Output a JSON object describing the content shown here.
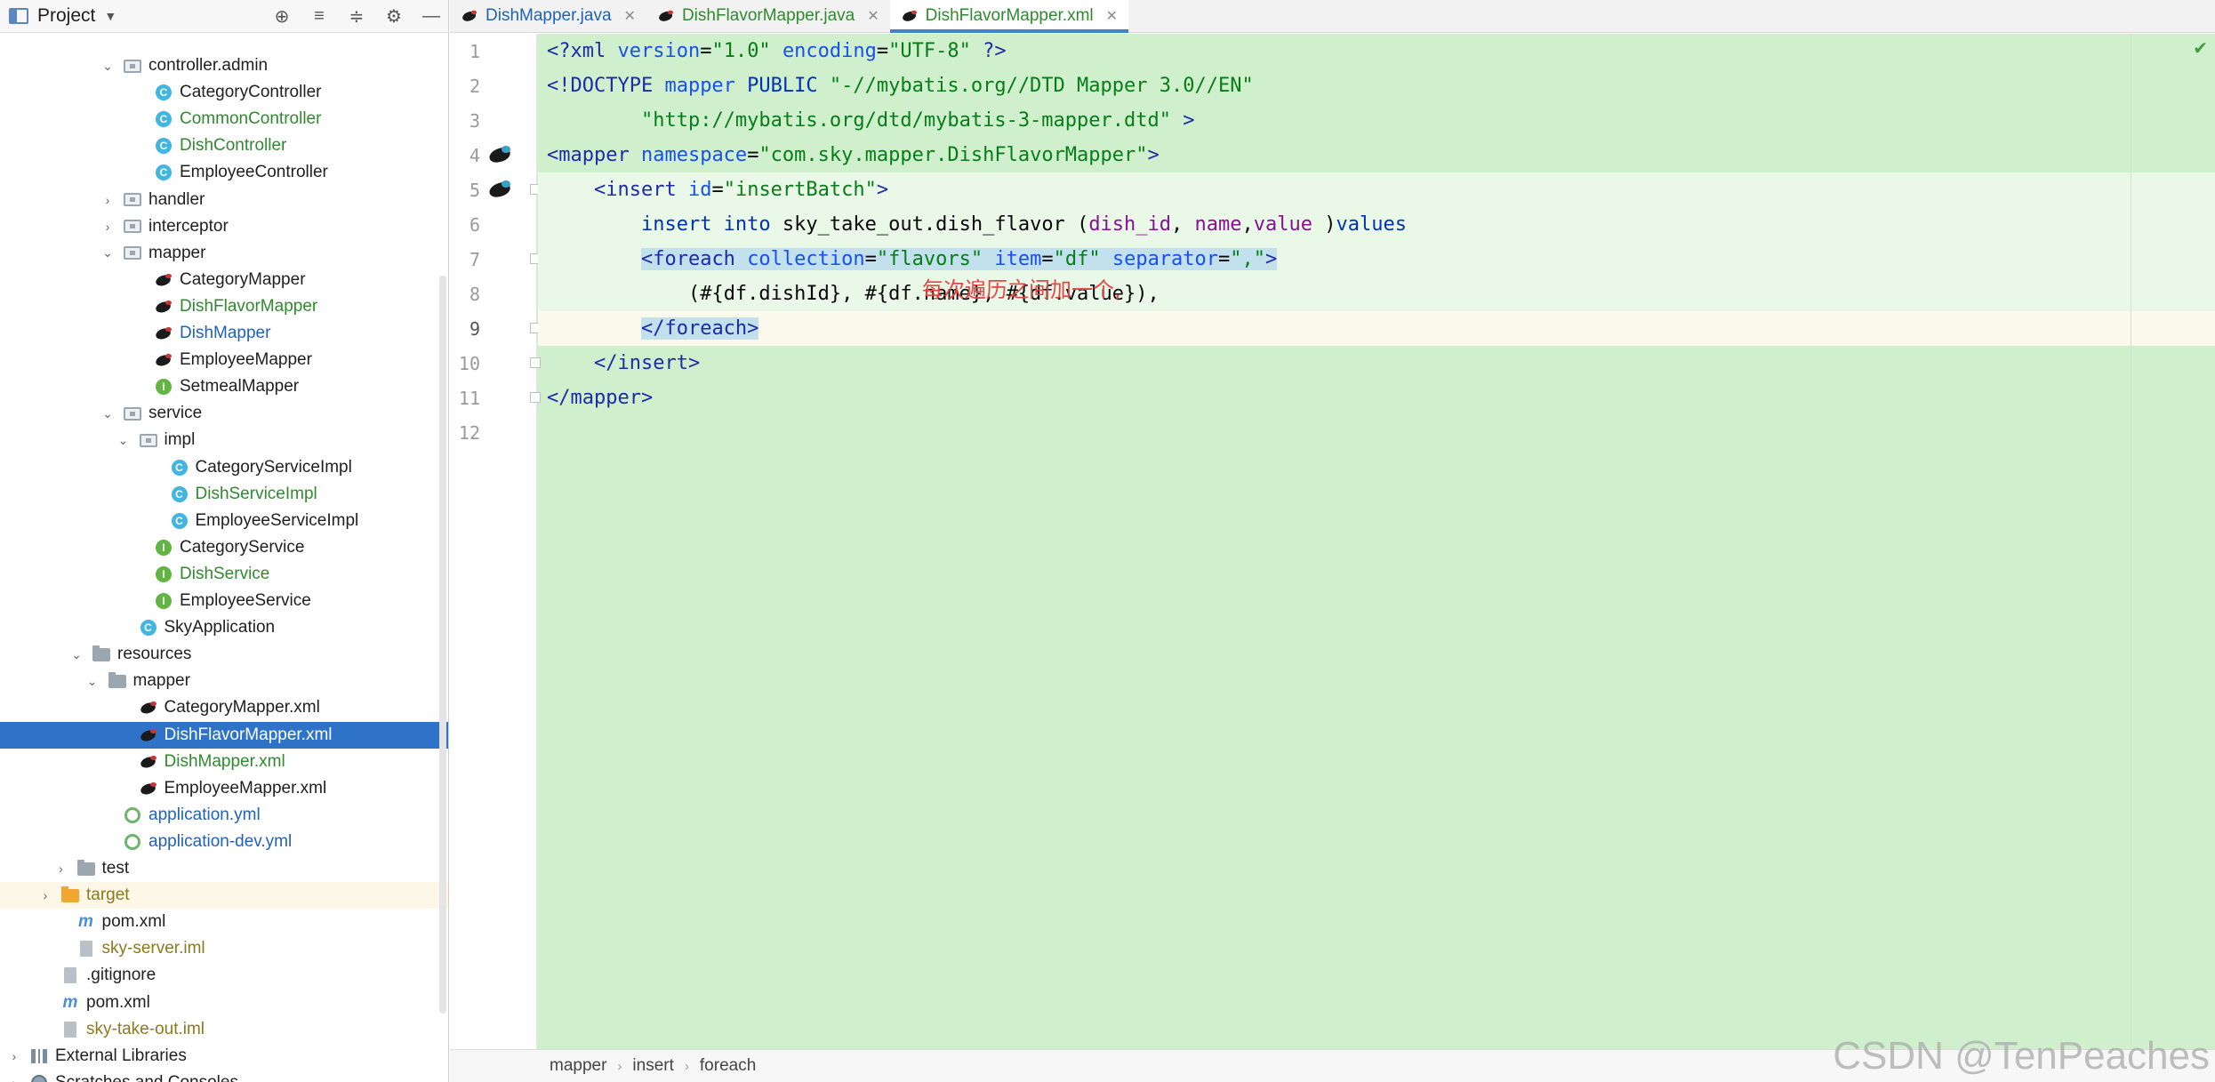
{
  "project_panel": {
    "title": "Project",
    "tools": [
      "globe-icon",
      "expand-all-icon",
      "collapse-all-icon",
      "gear-icon",
      "hide-icon"
    ],
    "tree": [
      {
        "label": "controller.admin",
        "depth": 6,
        "arrow": "down",
        "icon": "package",
        "color": "dark"
      },
      {
        "label": "CategoryController",
        "depth": 8,
        "arrow": "",
        "icon": "class",
        "color": "dark"
      },
      {
        "label": "CommonController",
        "depth": 8,
        "arrow": "",
        "icon": "class",
        "color": "green"
      },
      {
        "label": "DishController",
        "depth": 8,
        "arrow": "",
        "icon": "class",
        "color": "green"
      },
      {
        "label": "EmployeeController",
        "depth": 8,
        "arrow": "",
        "icon": "class",
        "color": "dark"
      },
      {
        "label": "handler",
        "depth": 6,
        "arrow": "right",
        "icon": "package",
        "color": "dark"
      },
      {
        "label": "interceptor",
        "depth": 6,
        "arrow": "right",
        "icon": "package",
        "color": "dark"
      },
      {
        "label": "mapper",
        "depth": 6,
        "arrow": "down",
        "icon": "package",
        "color": "dark"
      },
      {
        "label": "CategoryMapper",
        "depth": 8,
        "arrow": "",
        "icon": "bird",
        "color": "dark"
      },
      {
        "label": "DishFlavorMapper",
        "depth": 8,
        "arrow": "",
        "icon": "bird",
        "color": "green"
      },
      {
        "label": "DishMapper",
        "depth": 8,
        "arrow": "",
        "icon": "bird",
        "color": "blue"
      },
      {
        "label": "EmployeeMapper",
        "depth": 8,
        "arrow": "",
        "icon": "bird",
        "color": "dark"
      },
      {
        "label": "SetmealMapper",
        "depth": 8,
        "arrow": "",
        "icon": "interface",
        "color": "dark"
      },
      {
        "label": "service",
        "depth": 6,
        "arrow": "down",
        "icon": "package",
        "color": "dark"
      },
      {
        "label": "impl",
        "depth": 7,
        "arrow": "down",
        "icon": "package",
        "color": "dark"
      },
      {
        "label": "CategoryServiceImpl",
        "depth": 9,
        "arrow": "",
        "icon": "class",
        "color": "dark"
      },
      {
        "label": "DishServiceImpl",
        "depth": 9,
        "arrow": "",
        "icon": "class",
        "color": "green"
      },
      {
        "label": "EmployeeServiceImpl",
        "depth": 9,
        "arrow": "",
        "icon": "class",
        "color": "dark"
      },
      {
        "label": "CategoryService",
        "depth": 8,
        "arrow": "",
        "icon": "interface",
        "color": "dark"
      },
      {
        "label": "DishService",
        "depth": 8,
        "arrow": "",
        "icon": "interface",
        "color": "green"
      },
      {
        "label": "EmployeeService",
        "depth": 8,
        "arrow": "",
        "icon": "interface",
        "color": "dark"
      },
      {
        "label": "SkyApplication",
        "depth": 7,
        "arrow": "",
        "icon": "class",
        "color": "dark"
      },
      {
        "label": "resources",
        "depth": 4,
        "arrow": "down",
        "icon": "folder",
        "color": "dark"
      },
      {
        "label": "mapper",
        "depth": 5,
        "arrow": "down",
        "icon": "folder",
        "color": "dark"
      },
      {
        "label": "CategoryMapper.xml",
        "depth": 7,
        "arrow": "",
        "icon": "bird",
        "color": "dark"
      },
      {
        "label": "DishFlavorMapper.xml",
        "depth": 7,
        "arrow": "",
        "icon": "bird",
        "color": "dark",
        "selected": true
      },
      {
        "label": "DishMapper.xml",
        "depth": 7,
        "arrow": "",
        "icon": "bird",
        "color": "green"
      },
      {
        "label": "EmployeeMapper.xml",
        "depth": 7,
        "arrow": "",
        "icon": "bird",
        "color": "dark"
      },
      {
        "label": "application.yml",
        "depth": 6,
        "arrow": "",
        "icon": "yml",
        "color": "blue"
      },
      {
        "label": "application-dev.yml",
        "depth": 6,
        "arrow": "",
        "icon": "yml",
        "color": "blue"
      },
      {
        "label": "test",
        "depth": 3,
        "arrow": "right",
        "icon": "folder",
        "color": "dark"
      },
      {
        "label": "target",
        "depth": 2,
        "arrow": "right",
        "icon": "folder-orange",
        "color": "olive",
        "highlight": true
      },
      {
        "label": "pom.xml",
        "depth": 3,
        "arrow": "",
        "icon": "maven",
        "color": "dark"
      },
      {
        "label": "sky-server.iml",
        "depth": 3,
        "arrow": "",
        "icon": "file",
        "color": "olive"
      },
      {
        "label": ".gitignore",
        "depth": 2,
        "arrow": "",
        "icon": "file",
        "color": "dark"
      },
      {
        "label": "pom.xml",
        "depth": 2,
        "arrow": "",
        "icon": "maven",
        "color": "dark"
      },
      {
        "label": "sky-take-out.iml",
        "depth": 2,
        "arrow": "",
        "icon": "file",
        "color": "olive"
      },
      {
        "label": "External Libraries",
        "depth": 0,
        "arrow": "right",
        "icon": "library",
        "color": "dark"
      },
      {
        "label": "Scratches and Consoles",
        "depth": 0,
        "arrow": "right",
        "icon": "scratch",
        "color": "dark"
      }
    ]
  },
  "editor": {
    "tabs": [
      {
        "label": "DishMapper.java",
        "active": false,
        "color": "blue"
      },
      {
        "label": "DishFlavorMapper.java",
        "active": false,
        "color": "green"
      },
      {
        "label": "DishFlavorMapper.xml",
        "active": true,
        "color": "green"
      }
    ],
    "current_line": 9,
    "code": [
      [
        [
          "<?",
          "tag"
        ],
        [
          "xml ",
          "tag"
        ],
        [
          "version",
          "attr"
        ],
        [
          "=",
          "punct"
        ],
        [
          "\"1.0\"",
          "str"
        ],
        [
          " ",
          "plain"
        ],
        [
          "encoding",
          "attr"
        ],
        [
          "=",
          "punct"
        ],
        [
          "\"UTF-8\"",
          "str"
        ],
        [
          " ?>",
          "tag"
        ]
      ],
      [
        [
          "<!DOCTYPE ",
          "tag"
        ],
        [
          "mapper ",
          "attr"
        ],
        [
          "PUBLIC ",
          "kw"
        ],
        [
          "\"-//mybatis.org//DTD Mapper 3.0//EN\"",
          "str"
        ]
      ],
      [
        [
          "        ",
          "plain"
        ],
        [
          "\"http://mybatis.org/dtd/mybatis-3-mapper.dtd\"",
          "str"
        ],
        [
          " >",
          "tag"
        ]
      ],
      [
        [
          "<mapper ",
          "tag"
        ],
        [
          "namespace",
          "attr"
        ],
        [
          "=",
          "punct"
        ],
        [
          "\"com.sky.mapper.DishFlavorMapper\"",
          "str"
        ],
        [
          ">",
          "tag"
        ]
      ],
      [
        [
          "    ",
          "plain"
        ],
        [
          "<insert ",
          "tag"
        ],
        [
          "id",
          "attr"
        ],
        [
          "=",
          "punct"
        ],
        [
          "\"insertBatch\"",
          "str"
        ],
        [
          ">",
          "tag"
        ]
      ],
      [
        [
          "        ",
          "plain"
        ],
        [
          "insert into ",
          "kw"
        ],
        [
          "sky_take_out.dish_flavor ",
          "plain"
        ],
        [
          "(",
          "punct"
        ],
        [
          "dish_id",
          "col"
        ],
        [
          ", ",
          "punct"
        ],
        [
          "name",
          "col"
        ],
        [
          ",",
          "punct"
        ],
        [
          "value",
          "col"
        ],
        [
          " )",
          "punct"
        ],
        [
          "values",
          "kw"
        ]
      ],
      [
        [
          "        ",
          "plain"
        ],
        [
          "<foreach ",
          "tag-mark"
        ],
        [
          "collection",
          "attr-mark"
        ],
        [
          "=",
          "punct-mark"
        ],
        [
          "\"flavors\"",
          "str-mark"
        ],
        [
          " ",
          "plain-mark"
        ],
        [
          "item",
          "attr-mark"
        ],
        [
          "=",
          "punct-mark"
        ],
        [
          "\"df\"",
          "str-mark"
        ],
        [
          " ",
          "plain-mark"
        ],
        [
          "separator",
          "attr-mark"
        ],
        [
          "=",
          "punct-mark"
        ],
        [
          "\",\"",
          "str-mark"
        ],
        [
          ">",
          "tag-mark"
        ]
      ],
      [
        [
          "            ",
          "plain"
        ],
        [
          "(#{df.dishId}, #{df.name}, #{df.value}),",
          "plain"
        ]
      ],
      [
        [
          "        ",
          "plain"
        ],
        [
          "</foreach>",
          "tag-mark"
        ]
      ],
      [
        [
          "    ",
          "plain"
        ],
        [
          "</insert>",
          "tag"
        ]
      ],
      [
        [
          "</mapper>",
          "tag"
        ]
      ],
      [
        [
          "",
          "plain"
        ]
      ]
    ],
    "gutter_icons": [
      4,
      5
    ],
    "annotation": "每次遍历之间加一个,",
    "status_icon": "check-icon"
  },
  "breadcrumb": [
    "mapper",
    "insert",
    "foreach"
  ],
  "watermark": "CSDN @TenPeaches"
}
